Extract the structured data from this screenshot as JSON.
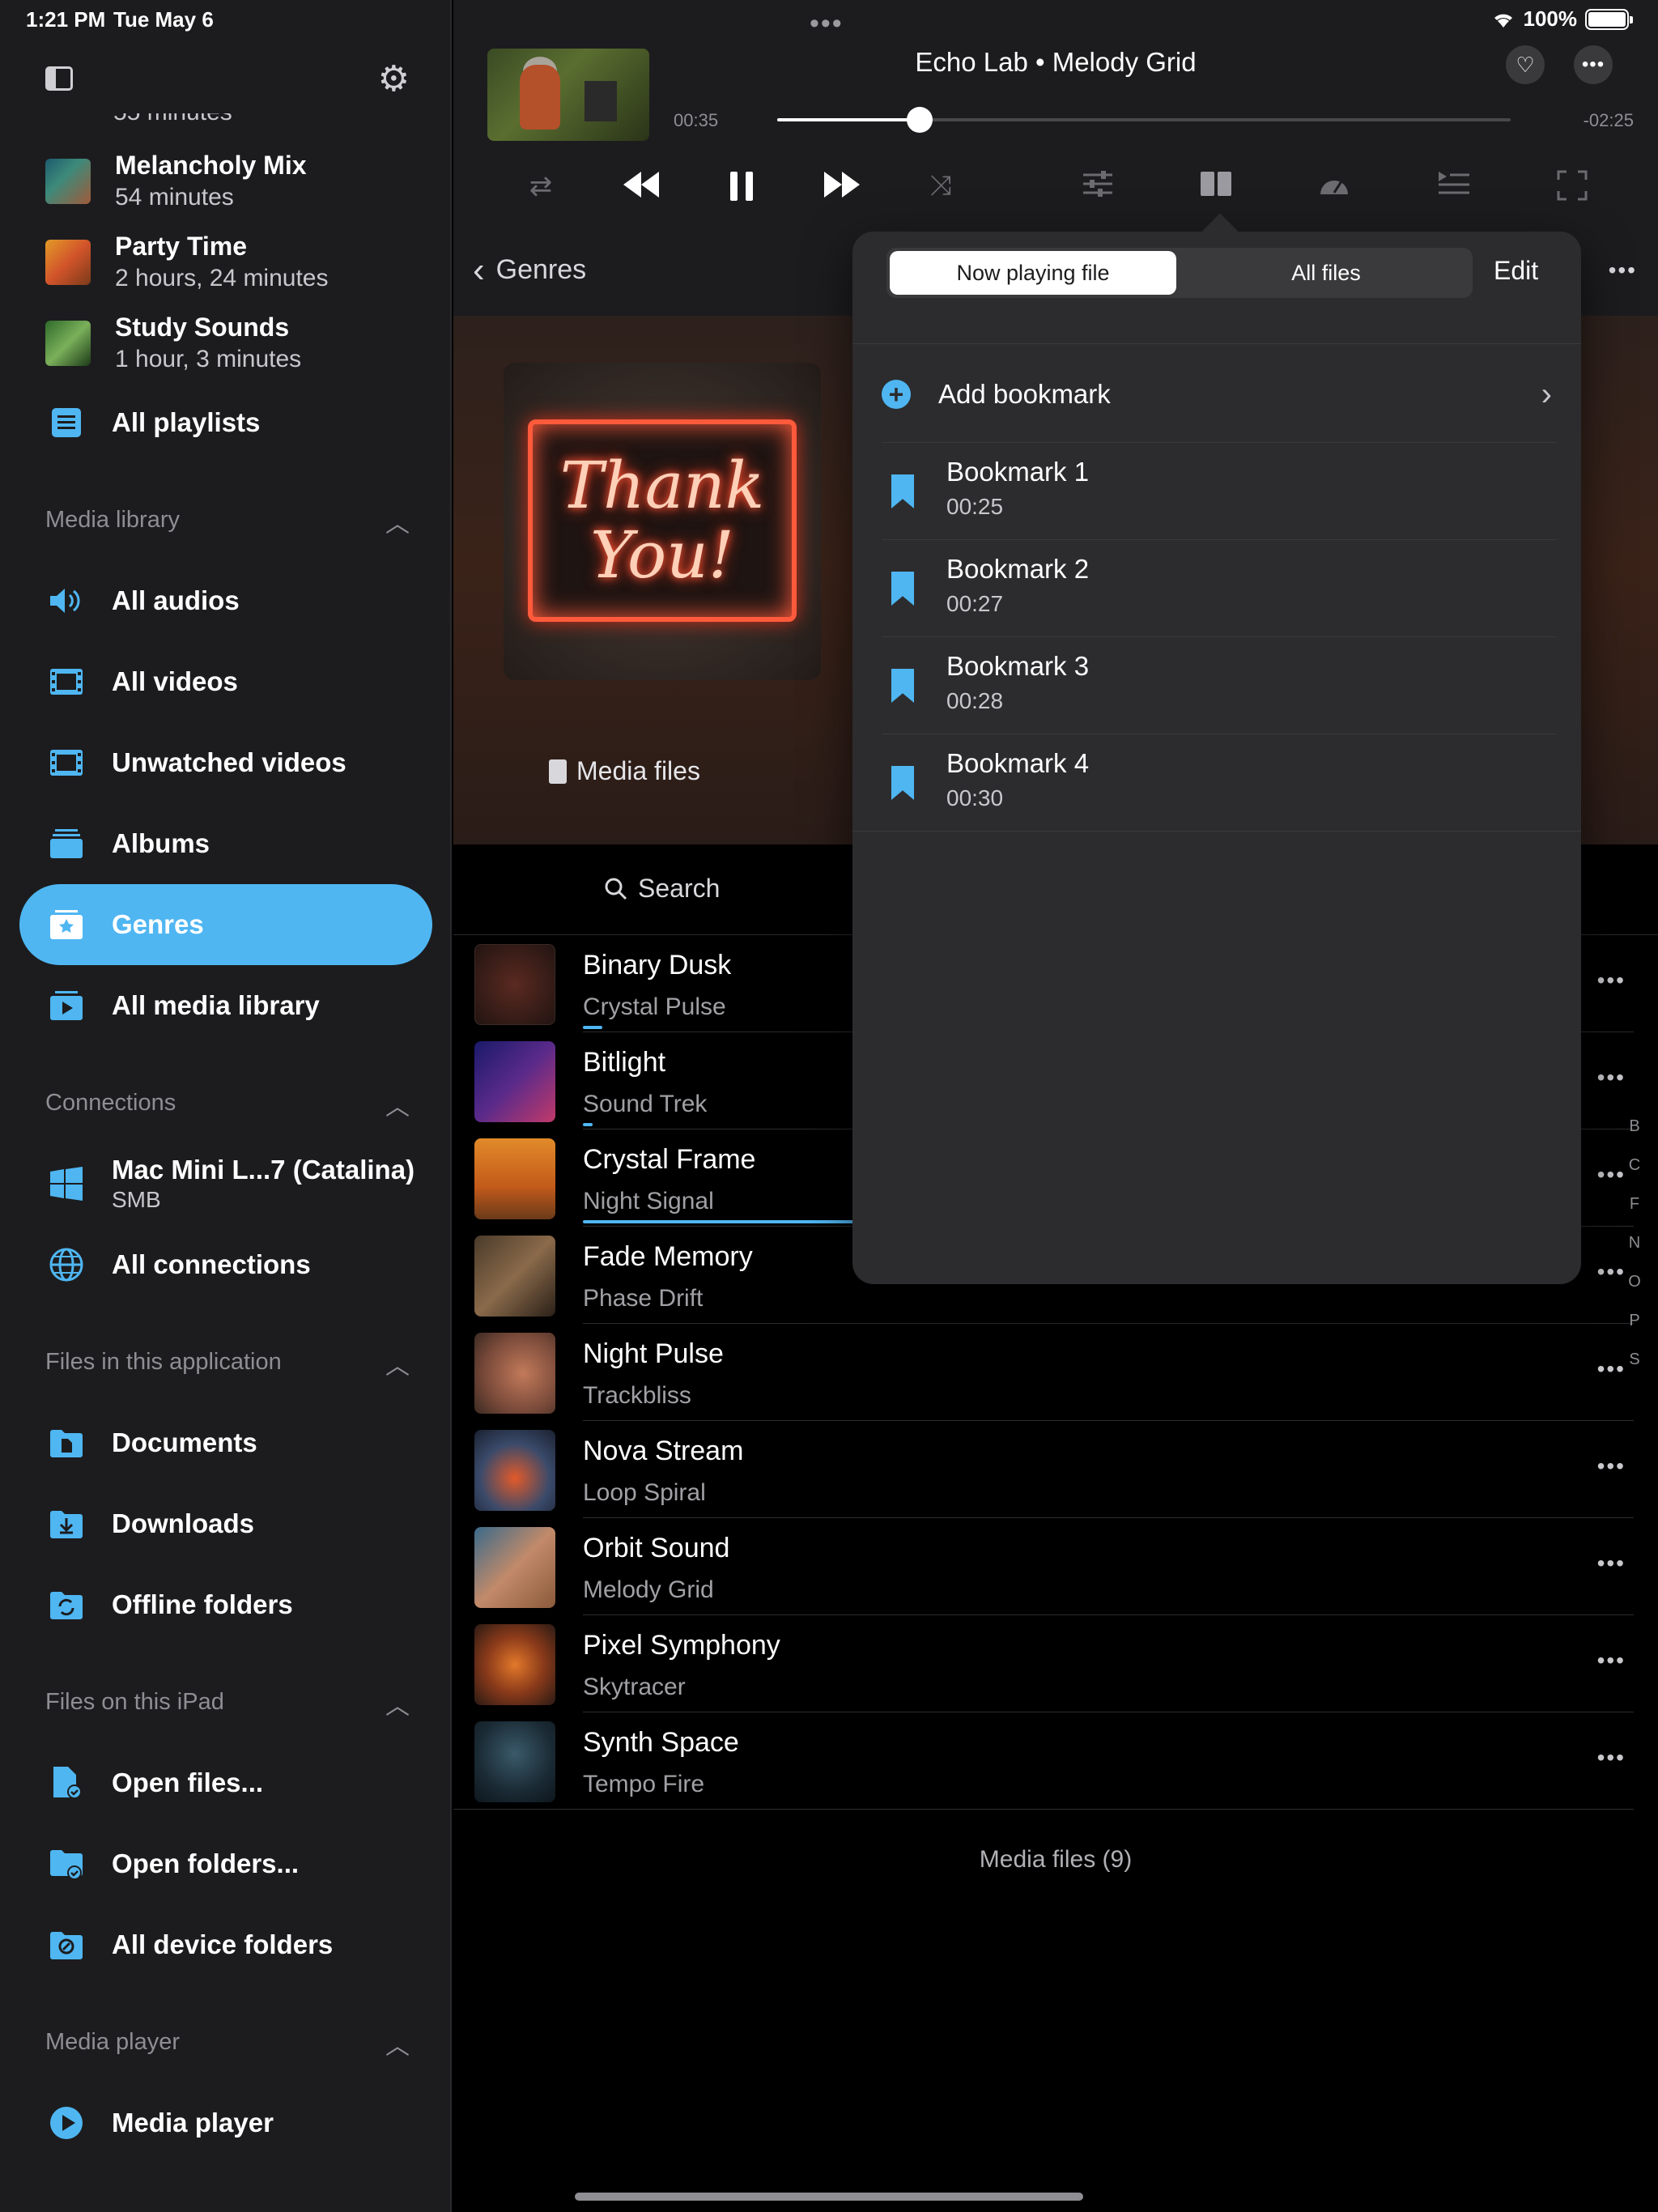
{
  "status_bar": {
    "time": "1:21 PM",
    "date": "Tue May 6",
    "battery": "100%"
  },
  "sidebar": {
    "partial_text": "55 minutes",
    "playlists": [
      {
        "title": "Melancholy Mix",
        "subtitle": "54 minutes"
      },
      {
        "title": "Party Time",
        "subtitle": "2 hours, 24 minutes"
      },
      {
        "title": "Study Sounds",
        "subtitle": "1 hour, 3 minutes"
      }
    ],
    "all_playlists": "All playlists",
    "sections": {
      "media_library": "Media library",
      "connections": "Connections",
      "files_app": "Files in this application",
      "files_ipad": "Files on this iPad",
      "media_player": "Media player"
    },
    "media_library_items": [
      "All audios",
      "All videos",
      "Unwatched videos",
      "Albums",
      "Genres",
      "All media library"
    ],
    "connection_item": {
      "title": "Mac Mini L...7 (Catalina)",
      "subtitle": "SMB"
    },
    "all_connections": "All connections",
    "files_app_items": [
      "Documents",
      "Downloads",
      "Offline folders"
    ],
    "files_ipad_items": [
      "Open files...",
      "Open folders...",
      "All device folders"
    ],
    "media_player_item": "Media player",
    "active_item": "Genres"
  },
  "player": {
    "title": "Echo Lab • Melody Grid",
    "elapsed": "00:35",
    "remaining": "-02:25",
    "progress": 0.194
  },
  "genre": {
    "back_label": "Genres",
    "artwork_text_line1": "Thank",
    "artwork_text_line2": "You!",
    "media_files_label": "Media files"
  },
  "search": {
    "placeholder": "Search"
  },
  "tracks": [
    {
      "title": "Binary Dusk",
      "artist": "Crystal Pulse",
      "progress": 0.02
    },
    {
      "title": "Bitlight",
      "artist": "Sound Trek",
      "progress": 0.01
    },
    {
      "title": "Crystal Frame",
      "artist": "Night Signal",
      "progress": 0.4
    },
    {
      "title": "Fade Memory",
      "artist": "Phase Drift",
      "progress": 0
    },
    {
      "title": "Night Pulse",
      "artist": "Trackbliss",
      "progress": 0
    },
    {
      "title": "Nova Stream",
      "artist": "Loop Spiral",
      "progress": 0
    },
    {
      "title": "Orbit Sound",
      "artist": "Melody Grid",
      "progress": 0
    },
    {
      "title": "Pixel Symphony",
      "artist": "Skytracer",
      "progress": 0
    },
    {
      "title": "Synth Space",
      "artist": "Tempo Fire",
      "progress": 0
    }
  ],
  "index_letters": [
    "B",
    "C",
    "F",
    "N",
    "O",
    "P",
    "S"
  ],
  "media_files_count": "Media files (9)",
  "bookmarks_popover": {
    "segments": [
      "Now playing file",
      "All files"
    ],
    "selected_segment": "Now playing file",
    "edit_label": "Edit",
    "add_label": "Add bookmark",
    "bookmarks": [
      {
        "name": "Bookmark 1",
        "time": "00:25"
      },
      {
        "name": "Bookmark 2",
        "time": "00:27"
      },
      {
        "name": "Bookmark 3",
        "time": "00:28"
      },
      {
        "name": "Bookmark 4",
        "time": "00:30"
      }
    ]
  },
  "colors": {
    "accent": "#4fb6f2",
    "sidebar_bg": "#1c1c1e",
    "popover_bg": "#2c2c2e"
  },
  "icons": {
    "sidebar_toggle": "sidebar-icon",
    "settings": "gear-icon",
    "shuffle": "shuffle-icon",
    "repeat": "repeat-icon",
    "bookmark": "bookmark-icon"
  }
}
